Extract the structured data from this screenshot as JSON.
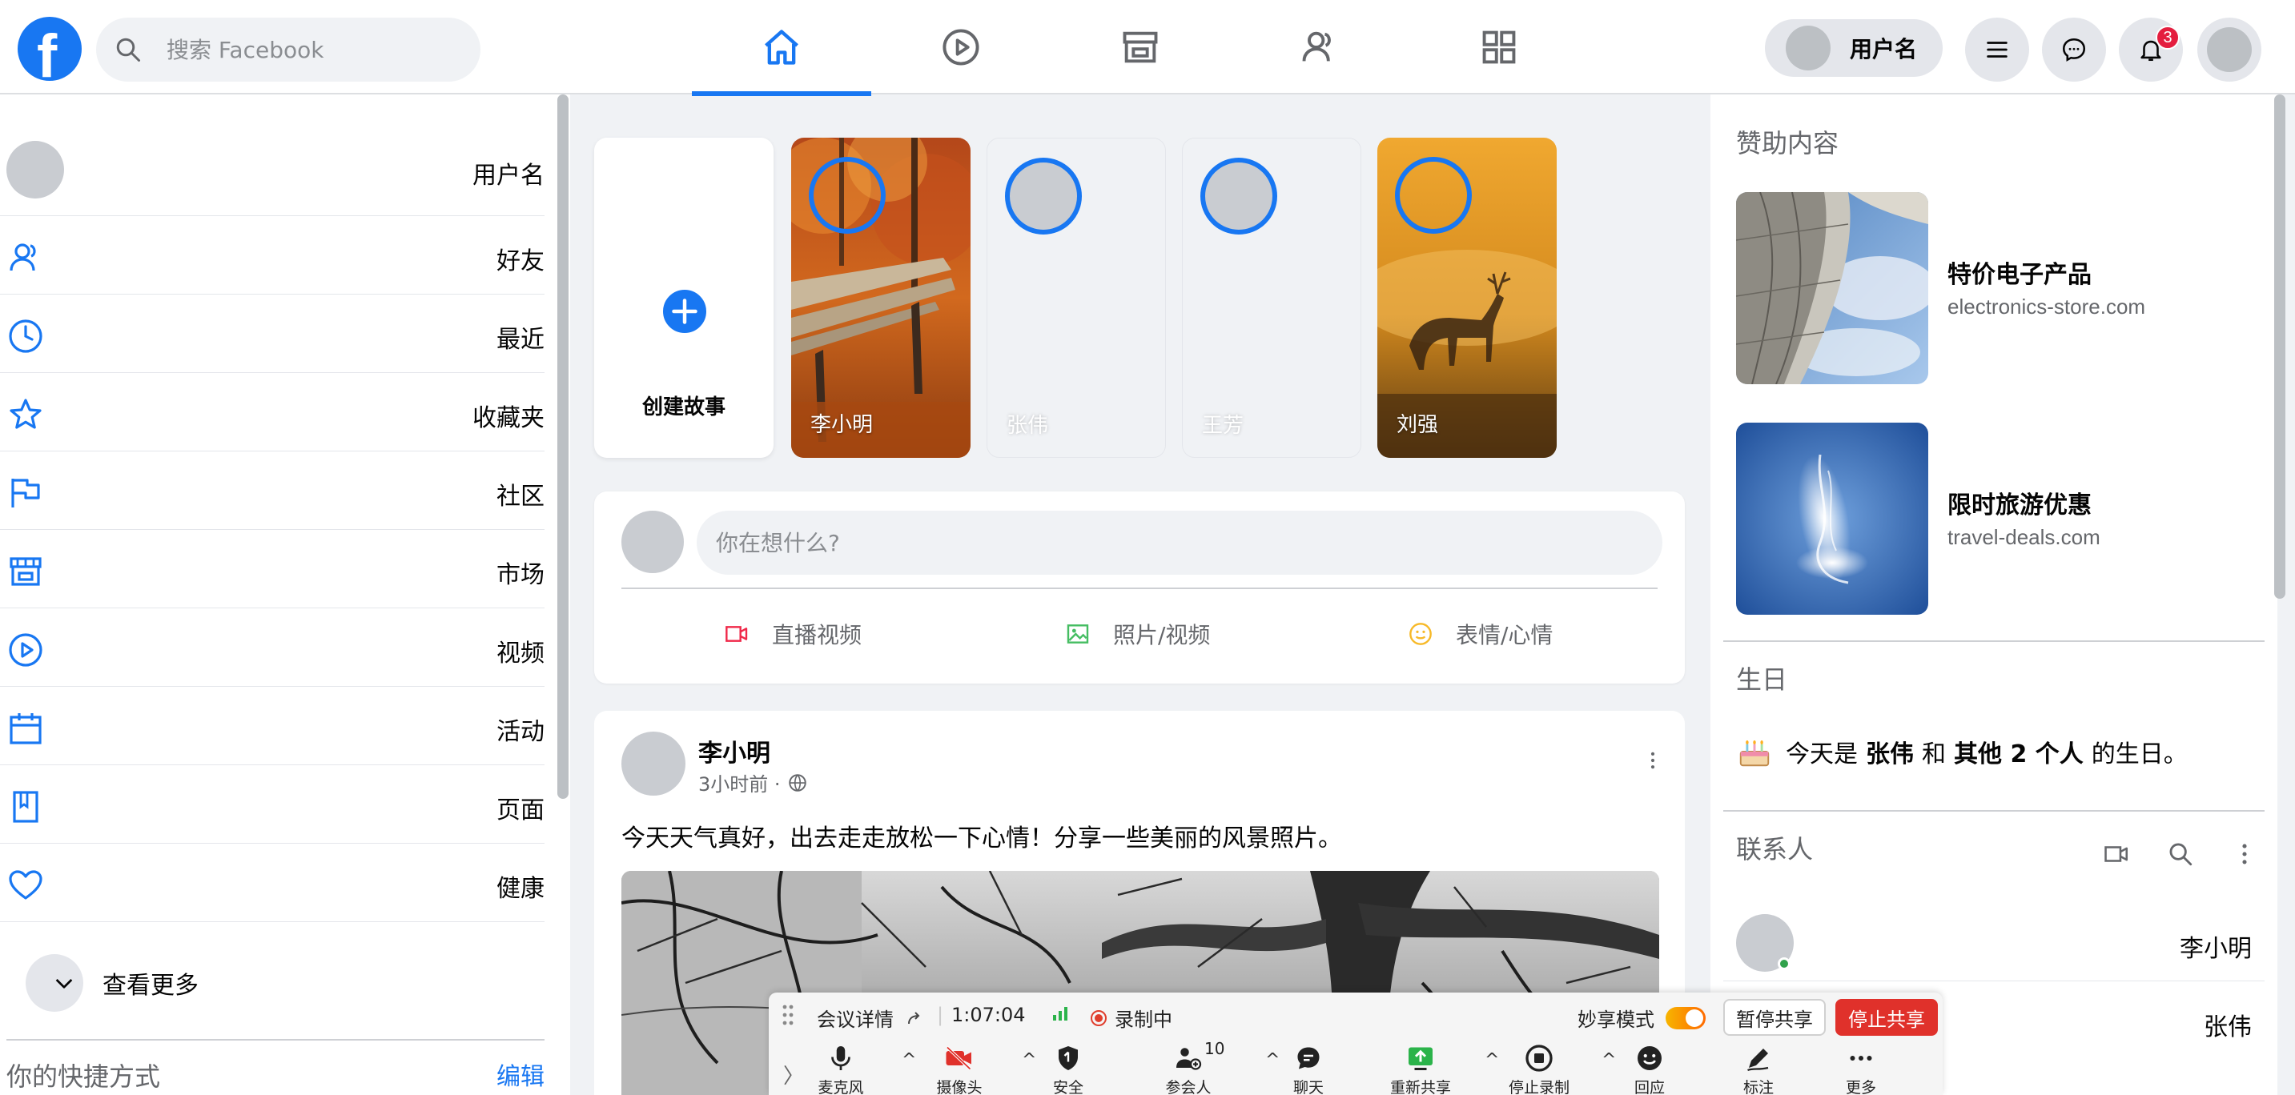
{
  "nav": {
    "logo_letter": "f",
    "search_placeholder": "搜索 Facebook",
    "tabs": [
      "home-icon",
      "video-icon",
      "marketplace-icon",
      "groups-icon",
      "apps-grid-icon"
    ],
    "user_name": "用户名",
    "notification_count": "3"
  },
  "left": {
    "user_name": "用户名",
    "items": [
      {
        "label": "好友",
        "icon": "friends-icon"
      },
      {
        "label": "最近",
        "icon": "clock-icon"
      },
      {
        "label": "收藏夹",
        "icon": "star-icon"
      },
      {
        "label": "社区",
        "icon": "flag-icon"
      },
      {
        "label": "市场",
        "icon": "store-icon"
      },
      {
        "label": "视频",
        "icon": "play-icon"
      },
      {
        "label": "活动",
        "icon": "calendar-icon"
      },
      {
        "label": "页面",
        "icon": "book-icon"
      },
      {
        "label": "健康",
        "icon": "heart-icon"
      }
    ],
    "see_more": "查看更多",
    "shortcuts_title": "你的快捷方式",
    "shortcuts_edit": "编辑"
  },
  "stories": {
    "create_label": "创建故事",
    "items": [
      {
        "name": "李小明"
      },
      {
        "name": "张伟"
      },
      {
        "name": "王芳"
      },
      {
        "name": "刘强"
      }
    ]
  },
  "composer": {
    "placeholder": "你在想什么?",
    "live": "直播视频",
    "photo": "照片/视频",
    "feeling": "表情/心情"
  },
  "post": {
    "author": "李小明",
    "time": "3小时前 ·",
    "text": "今天天气真好，出去走走放松一下心情！分享一些美丽的风景照片。"
  },
  "right": {
    "sponsored_title": "赞助内容",
    "ads": [
      {
        "title": "特价电子产品",
        "url": "electronics-store.com"
      },
      {
        "title": "限时旅游优惠",
        "url": "travel-deals.com"
      }
    ],
    "birthday_title": "生日",
    "birthday": {
      "prefix": "今天是",
      "name": "张伟",
      "and": "和",
      "others": "其他 2 个人",
      "suffix": "的生日。"
    },
    "contacts_title": "联系人",
    "contacts": [
      {
        "name": "李小明",
        "online": true
      },
      {
        "name": "张伟",
        "online": false
      }
    ]
  },
  "zoom": {
    "meeting_details": "会议详情",
    "timer": "1:07:04",
    "recording": "录制中",
    "smart_share": "妙享模式",
    "pause_share": "暂停共享",
    "stop_share": "停止共享",
    "participants_count": "10",
    "tools": [
      "麦克风",
      "摄像头",
      "安全",
      "参会人",
      "聊天",
      "重新共享",
      "停止录制",
      "回应",
      "标注",
      "更多"
    ]
  }
}
